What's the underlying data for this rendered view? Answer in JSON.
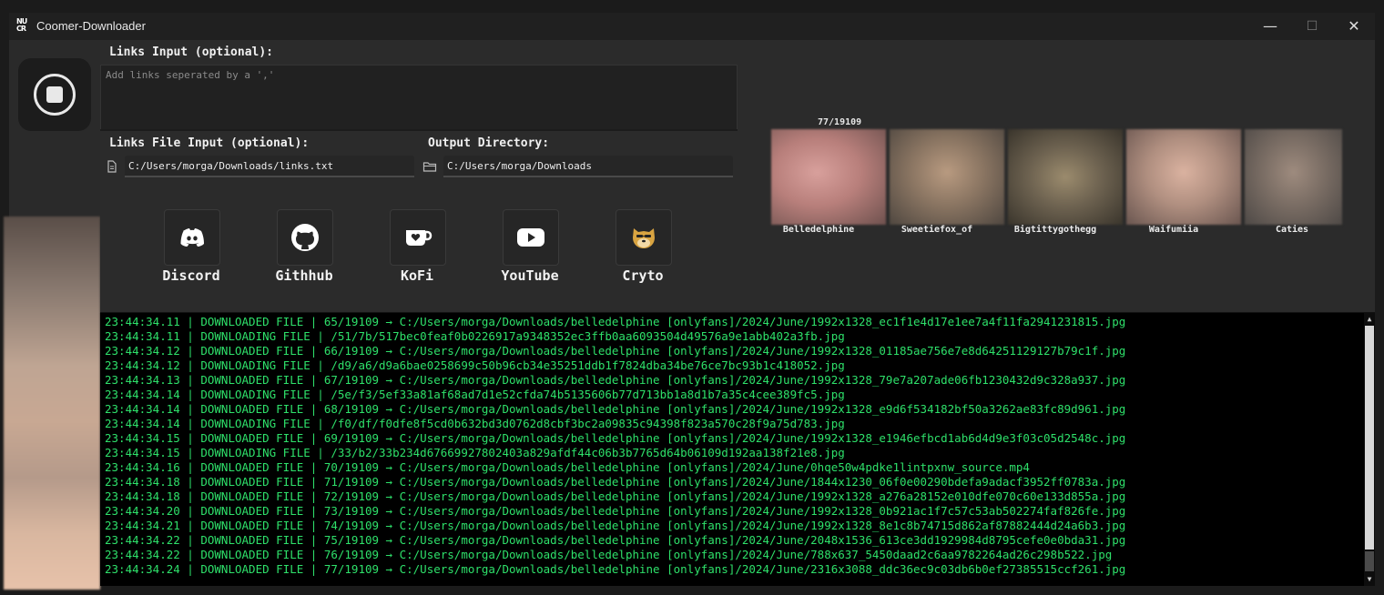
{
  "window": {
    "title": "Coomer-Downloader",
    "logo_text": "NU CR"
  },
  "inputs": {
    "links_label": "Links Input (optional):",
    "links_placeholder": "Add links seperated by a ','",
    "file_label": "Links File Input (optional):",
    "file_value": "C:/Users/morga/Downloads/links.txt",
    "output_label": "Output Directory:",
    "output_value": "C:/Users/morga/Downloads"
  },
  "social": [
    {
      "label": "Discord",
      "icon": "discord-icon"
    },
    {
      "label": "Githhub",
      "icon": "github-icon"
    },
    {
      "label": "KoFi",
      "icon": "kofi-icon"
    },
    {
      "label": "YouTube",
      "icon": "youtube-icon"
    },
    {
      "label": "Cryto",
      "icon": "doge-icon"
    }
  ],
  "progress": {
    "counter": "77/19109"
  },
  "creators": [
    {
      "name": "Belledelphine",
      "color_a": "#c98f8c",
      "color_b": "#7d5a57"
    },
    {
      "name": "Sweetiefox_of",
      "color_a": "#a68a72",
      "color_b": "#5a5048"
    },
    {
      "name": "Bigtittygothegg",
      "color_a": "#8a7a5d",
      "color_b": "#3f3a30"
    },
    {
      "name": "Waifumiia",
      "color_a": "#c7a08e",
      "color_b": "#6f5a55"
    },
    {
      "name": "Caties",
      "color_a": "#8b7b70",
      "color_b": "#55504c"
    }
  ],
  "log": [
    "23:44:34.11 | DOWNLOADED FILE | 65/19109 → C:/Users/morga/Downloads/belledelphine [onlyfans]/2024/June/1992x1328_ec1f1e4d17e1ee7a4f11fa2941231815.jpg",
    "23:44:34.11 | DOWNLOADING FILE | /51/7b/517bec0feaf0b0226917a9348352ec3ffb0aa6093504d49576a9e1abb402a3fb.jpg",
    "23:44:34.12 | DOWNLOADED FILE | 66/19109 → C:/Users/morga/Downloads/belledelphine [onlyfans]/2024/June/1992x1328_01185ae756e7e8d64251129127b79c1f.jpg",
    "23:44:34.12 | DOWNLOADING FILE | /d9/a6/d9a6bae0258699c50b96cb34e35251ddb1f7824dba34be76ce7bc93b1c418052.jpg",
    "23:44:34.13 | DOWNLOADED FILE | 67/19109 → C:/Users/morga/Downloads/belledelphine [onlyfans]/2024/June/1992x1328_79e7a207ade06fb1230432d9c328a937.jpg",
    "23:44:34.14 | DOWNLOADING FILE | /5e/f3/5ef33a81af68ad7d1e52cfda74b5135606b77d713bb1a8d1b7a35c4cee389fc5.jpg",
    "23:44:34.14 | DOWNLOADED FILE | 68/19109 → C:/Users/morga/Downloads/belledelphine [onlyfans]/2024/June/1992x1328_e9d6f534182bf50a3262ae83fc89d961.jpg",
    "23:44:34.14 | DOWNLOADING FILE | /f0/df/f0dfe8f5cd0b632bd3d0762d8cbf3bc2a09835c94398f823a570c28f9a75d783.jpg",
    "23:44:34.15 | DOWNLOADED FILE | 69/19109 → C:/Users/morga/Downloads/belledelphine [onlyfans]/2024/June/1992x1328_e1946efbcd1ab6d4d9e3f03c05d2548c.jpg",
    "23:44:34.15 | DOWNLOADING FILE | /33/b2/33b234d67669927802403a829afdf44c06b3b7765d64b06109d192aa138f21e8.jpg",
    "23:44:34.16 | DOWNLOADED FILE | 70/19109 → C:/Users/morga/Downloads/belledelphine [onlyfans]/2024/June/0hqe50w4pdke1lintpxnw_source.mp4",
    "23:44:34.18 | DOWNLOADED FILE | 71/19109 → C:/Users/morga/Downloads/belledelphine [onlyfans]/2024/June/1844x1230_06f0e00290bdefa9adacf3952ff0783a.jpg",
    "23:44:34.18 | DOWNLOADED FILE | 72/19109 → C:/Users/morga/Downloads/belledelphine [onlyfans]/2024/June/1992x1328_a276a28152e010dfe070c60e133d855a.jpg",
    "23:44:34.20 | DOWNLOADED FILE | 73/19109 → C:/Users/morga/Downloads/belledelphine [onlyfans]/2024/June/1992x1328_0b921ac1f7c57c53ab502274faf826fe.jpg",
    "23:44:34.21 | DOWNLOADED FILE | 74/19109 → C:/Users/morga/Downloads/belledelphine [onlyfans]/2024/June/1992x1328_8e1c8b74715d862af87882444d24a6b3.jpg",
    "23:44:34.22 | DOWNLOADED FILE | 75/19109 → C:/Users/morga/Downloads/belledelphine [onlyfans]/2024/June/2048x1536_613ce3dd1929984d8795cefe0e0bda31.jpg",
    "23:44:34.22 | DOWNLOADED FILE | 76/19109 → C:/Users/morga/Downloads/belledelphine [onlyfans]/2024/June/788x637_5450daad2c6aa9782264ad26c298b522.jpg",
    "23:44:34.24 | DOWNLOADED FILE | 77/19109 → C:/Users/morga/Downloads/belledelphine [onlyfans]/2024/June/2316x3088_ddc36ec9c03db6b0ef27385515ccf261.jpg"
  ],
  "colors": {
    "log_text": "#2ee06a",
    "background": "#1b1b1b",
    "panel": "#2b2b2b"
  }
}
